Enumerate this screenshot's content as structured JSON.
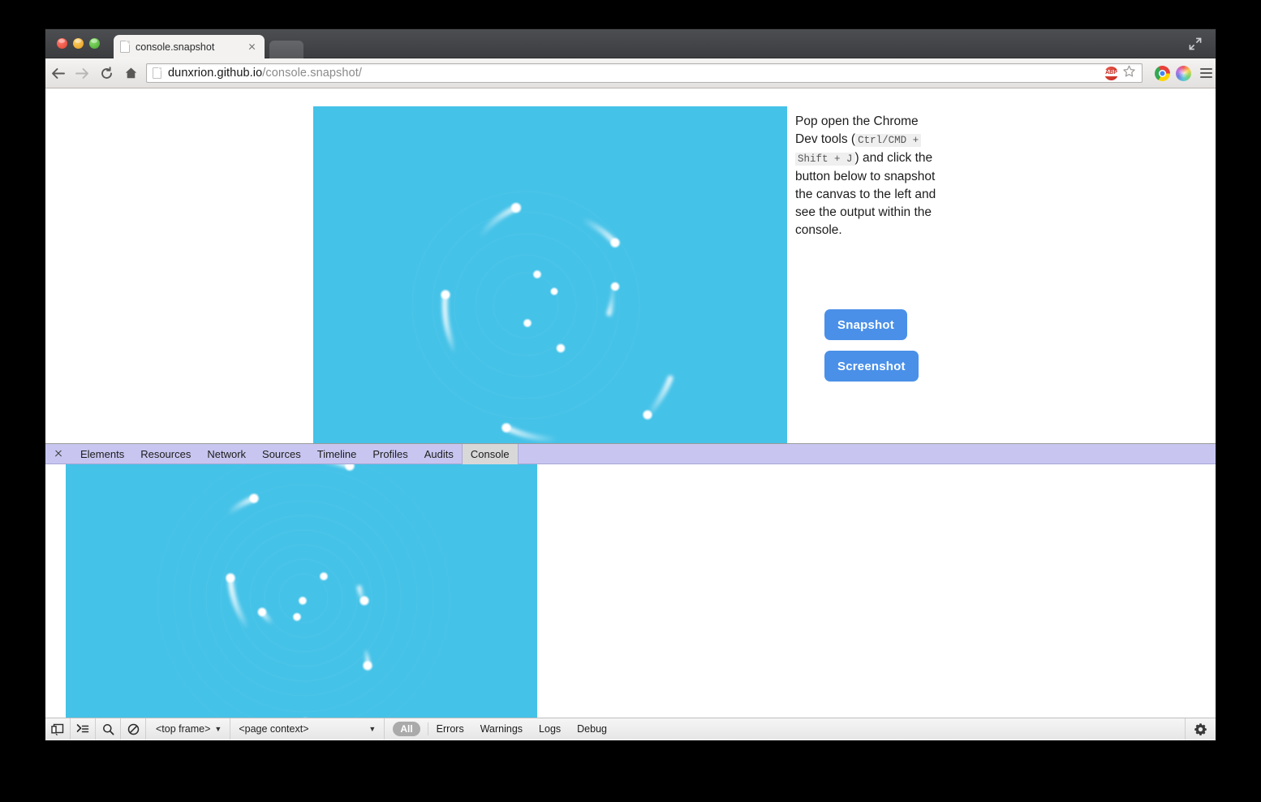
{
  "window": {
    "traffic_lights": [
      "close",
      "minimize",
      "maximize"
    ],
    "fullscreen_icon": "fullscreen-arrows-icon",
    "tab": {
      "title": "console.snapshot",
      "favicon": "page-icon",
      "close_icon": "close-icon"
    },
    "new_tab_label": ""
  },
  "toolbar": {
    "back_icon": "back-arrow-icon",
    "forward_icon": "forward-arrow-icon",
    "reload_icon": "reload-icon",
    "home_icon": "home-icon",
    "url_host": "dunxrion.github.io",
    "url_path": "/console.snapshot/",
    "url_full": "dunxrion.github.io/console.snapshot/",
    "abp_label": "ABP",
    "icons": [
      "abp-icon",
      "star-icon",
      "chrome-extension-icon",
      "color-wheel-icon",
      "menu-icon"
    ]
  },
  "page": {
    "clipped_text": "",
    "instructions": {
      "part1": "Pop open the Chrome Dev tools (",
      "kbd1": "Ctrl/CMD +",
      "kbd2": "Shift + J",
      "part2": ") and click the button below to snapshot the canvas to the left and see the output within the console."
    },
    "buttons": {
      "snapshot": "Snapshot",
      "screenshot": "Screenshot"
    },
    "canvas": {
      "background_color": "#45c2e8",
      "particle_color": "#ffffff",
      "description": "animated orbiting particles with comet trails"
    }
  },
  "devtools": {
    "close_icon": "close-icon",
    "tabs": [
      {
        "label": "Elements",
        "selected": false
      },
      {
        "label": "Resources",
        "selected": false
      },
      {
        "label": "Network",
        "selected": false
      },
      {
        "label": "Sources",
        "selected": false
      },
      {
        "label": "Timeline",
        "selected": false
      },
      {
        "label": "Profiles",
        "selected": false
      },
      {
        "label": "Audits",
        "selected": false
      },
      {
        "label": "Console",
        "selected": true
      }
    ],
    "console_output": {
      "type": "canvas-snapshot-image",
      "background_color": "#45c2e8"
    },
    "statusbar": {
      "dock_icon": "dock-to-side-icon",
      "prompt_icon": "console-prompt-icon",
      "search_icon": "search-icon",
      "clear_icon": "clear-console-icon",
      "frame_selector": "<top frame>",
      "context_selector": "<page context>",
      "caret": "▼",
      "all_label": "All",
      "filters": [
        "Errors",
        "Warnings",
        "Logs",
        "Debug"
      ],
      "gear_icon": "settings-gear-icon"
    }
  },
  "colors": {
    "canvas_blue": "#45c2e8",
    "button_blue": "#4a90e8",
    "devtools_tabbar": "#c8c6f0",
    "backdrop": "#000000"
  }
}
